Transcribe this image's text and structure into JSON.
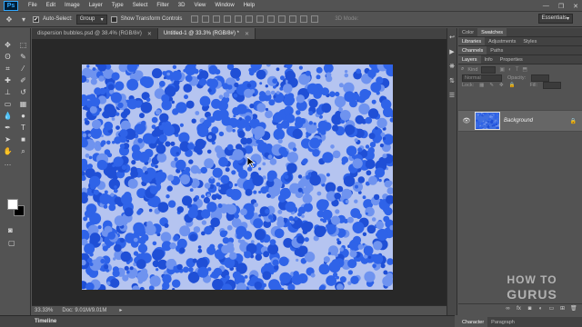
{
  "app": {
    "logo": "Ps",
    "menu": [
      "File",
      "Edit",
      "Image",
      "Layer",
      "Type",
      "Select",
      "Filter",
      "3D",
      "View",
      "Window",
      "Help"
    ]
  },
  "options": {
    "auto_select_label": "Auto-Select:",
    "auto_select_checked": true,
    "auto_select_value": "Group",
    "transform_label": "Show Transform Controls",
    "mode_3d_label": "3D Mode:",
    "workspace_value": "Essentials"
  },
  "tabs": [
    {
      "label": "dispersion bubbles.psd @ 38.4% (RGB/8#)",
      "active": false
    },
    {
      "label": "Untitled-1 @ 33.3% (RGB/8#) *",
      "active": true
    }
  ],
  "status": {
    "zoom": "33.33%",
    "doc": "Doc: 9.01M/9.01M"
  },
  "timeline_label": "Timeline",
  "panels": {
    "top_tabs": [
      "Color",
      "Swatches"
    ],
    "mid_tabs": [
      "Libraries",
      "Adjustments",
      "Styles"
    ],
    "channel_tabs": [
      "Channels",
      "Paths"
    ],
    "layer_tabs": [
      "Layers",
      "Info",
      "Properties"
    ],
    "kind_label": "Kind",
    "blend_mode": "Normal",
    "opacity_label": "Opacity:",
    "lock_label": "Lock:",
    "fill_label": "Fill:",
    "layer_name": "Background",
    "bottom_tabs": [
      "Character",
      "Paragraph"
    ]
  },
  "colors": {
    "bubble_dark": "#1f4fd6",
    "bubble_mid": "#2f63e8",
    "bubble_light": "#6f93ef",
    "canvas_bg": "#b5c4f0",
    "foreground": "#ffffff",
    "background": "#000000"
  },
  "icons": {
    "watermark_text": "HOW TO GURUS"
  }
}
